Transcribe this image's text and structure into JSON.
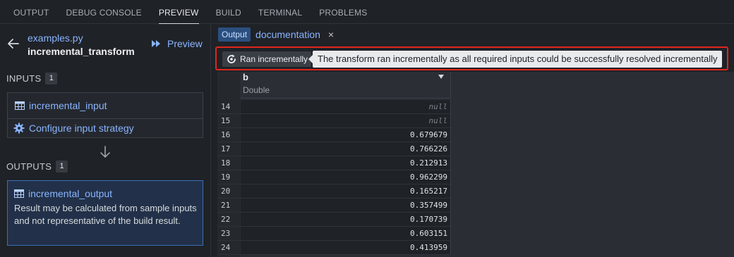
{
  "top_tabs": [
    {
      "label": "OUTPUT"
    },
    {
      "label": "DEBUG CONSOLE"
    },
    {
      "label": "PREVIEW",
      "active": true
    },
    {
      "label": "BUILD"
    },
    {
      "label": "TERMINAL"
    },
    {
      "label": "PROBLEMS"
    }
  ],
  "left_panel": {
    "file_name": "examples.py",
    "transform_name": "incremental_transform",
    "preview_label": "Preview",
    "inputs_label": "INPUTS",
    "inputs_count": "1",
    "input_dataset": "incremental_input",
    "configure_label": "Configure input strategy",
    "outputs_label": "OUTPUTS",
    "outputs_count": "1",
    "output_dataset": "incremental_output",
    "output_note": "Result may be calculated from sample inputs and not representative of the build result."
  },
  "right_panel": {
    "output_badge": "Output",
    "doc_tab": "documentation",
    "close_glyph": "×",
    "incremental_pill": "Ran incrementally",
    "tooltip": "The transform ran incrementally as all required inputs could be successfully resolved incrementally",
    "column": {
      "name": "b",
      "type": "Double"
    },
    "rows": [
      {
        "num": "14",
        "value": "null",
        "is_null": true
      },
      {
        "num": "15",
        "value": "null",
        "is_null": true
      },
      {
        "num": "16",
        "value": "0.679679"
      },
      {
        "num": "17",
        "value": "0.766226"
      },
      {
        "num": "18",
        "value": "0.212913"
      },
      {
        "num": "19",
        "value": "0.962299"
      },
      {
        "num": "20",
        "value": "0.165217"
      },
      {
        "num": "21",
        "value": "0.357499"
      },
      {
        "num": "22",
        "value": "0.170739"
      },
      {
        "num": "23",
        "value": "0.603151"
      },
      {
        "num": "24",
        "value": "0.413959"
      }
    ]
  },
  "colors": {
    "accent_link": "#8ab4ff",
    "highlight_border": "#e0261d",
    "output_card_border": "#3b6fb6"
  },
  "icons": [
    "back-arrow-icon",
    "play-fast-forward-icon",
    "table-icon",
    "gear-icon",
    "arrow-down-icon",
    "incremental-refresh-icon",
    "close-icon",
    "sort-caret-icon"
  ]
}
